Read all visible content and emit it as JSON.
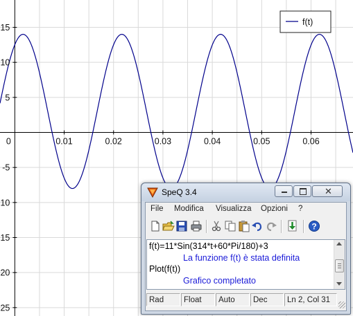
{
  "plot": {
    "x_range": [
      -0.003,
      0.0685
    ],
    "y_range": [
      -26.2,
      18.9
    ],
    "function": {
      "amplitude": 11,
      "omega": 314,
      "phase_deg": 60,
      "offset": 3
    },
    "x_ticks": [
      "0.01",
      "0.02",
      "0.03",
      "0.04",
      "0.05",
      "0.06"
    ],
    "x_tick_values": [
      0.01,
      0.02,
      0.03,
      0.04,
      0.05,
      0.06
    ],
    "origin_label": "0",
    "y_ticks": [
      "15",
      "10",
      "5",
      "0",
      "-5",
      "-10",
      "-15",
      "-20",
      "-25"
    ],
    "y_tick_values": [
      15,
      10,
      5,
      0,
      -5,
      -10,
      -15,
      -20,
      -25
    ],
    "legend": "f(t)",
    "line_color": "#00008b",
    "grid_color": "#d9d9d9"
  },
  "window": {
    "title": "SpeQ 3.4",
    "menu": [
      "File",
      "Modifica",
      "Visualizza",
      "Opzioni",
      "?"
    ],
    "toolbar_icons": [
      "new-icon",
      "open-icon",
      "save-icon",
      "print-icon",
      "cut-icon",
      "copy-icon",
      "paste-icon",
      "undo-icon",
      "redo-icon",
      "download-icon",
      "help-icon"
    ],
    "editor_lines": [
      {
        "text": "f(t)=11*Sin(314*t+60*Pi/180)+3",
        "type": "input"
      },
      {
        "text": "La funzione f(t) è stata definita",
        "type": "output"
      },
      {
        "text": "Plot(f(t))",
        "type": "input"
      },
      {
        "text": "Grafico completato",
        "type": "output"
      }
    ],
    "status": [
      "Rad",
      "Float",
      "Auto",
      "Dec",
      "Ln 2, Col 31"
    ]
  }
}
